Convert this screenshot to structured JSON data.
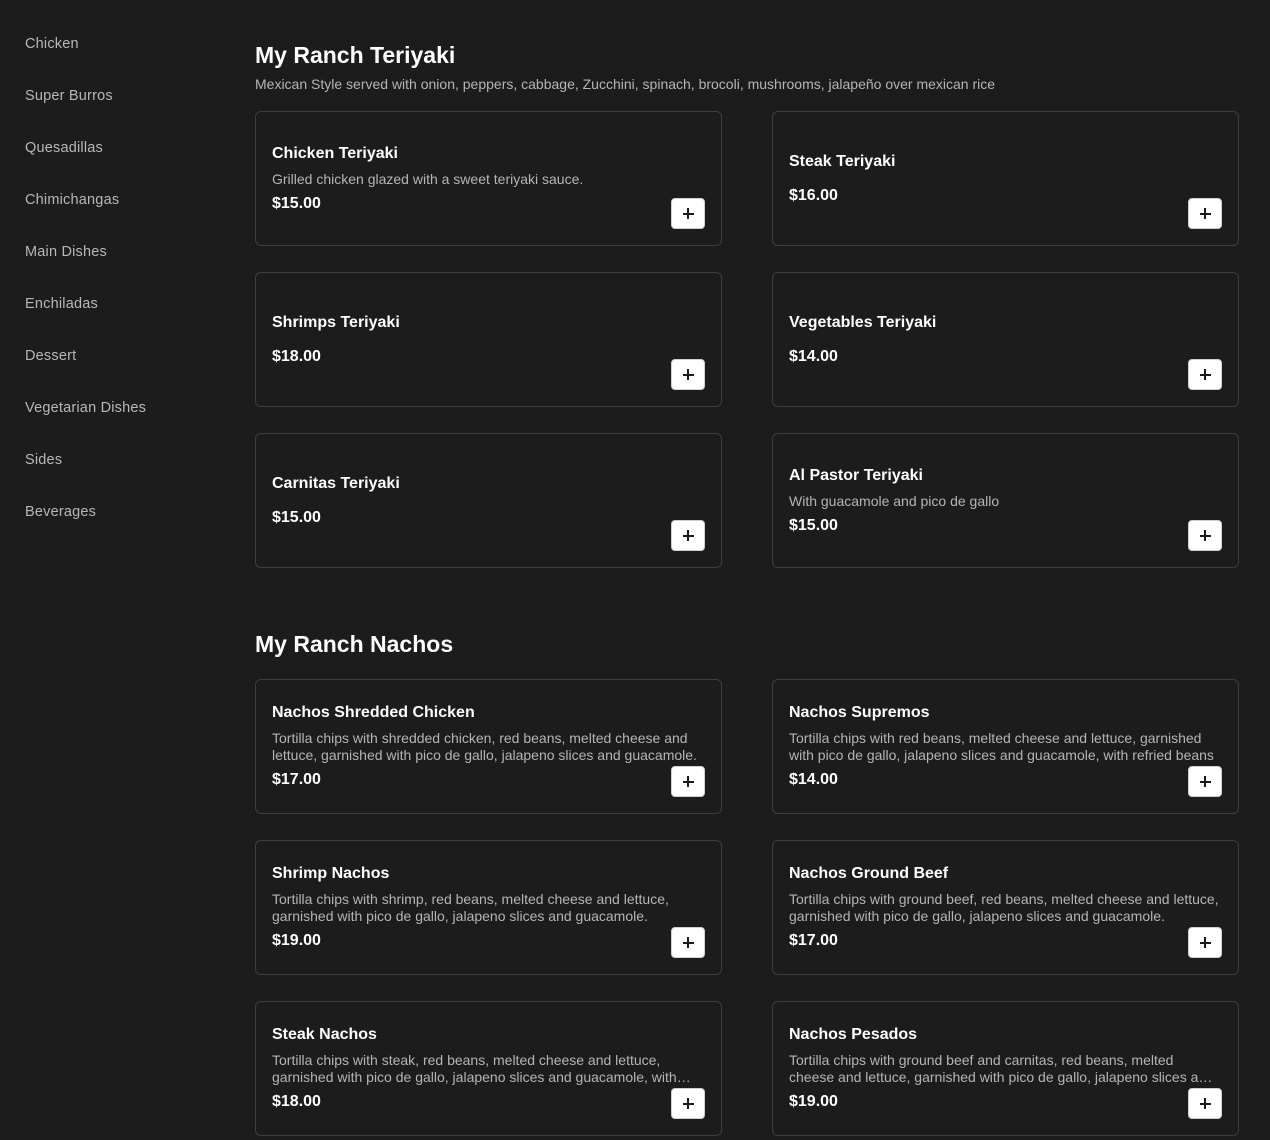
{
  "sidebar": {
    "items": [
      {
        "label": "Chicken"
      },
      {
        "label": "Super Burros"
      },
      {
        "label": "Quesadillas"
      },
      {
        "label": "Chimichangas"
      },
      {
        "label": "Main Dishes"
      },
      {
        "label": "Enchiladas"
      },
      {
        "label": "Dessert"
      },
      {
        "label": "Vegetarian Dishes"
      },
      {
        "label": "Sides"
      },
      {
        "label": "Beverages"
      }
    ]
  },
  "sections": [
    {
      "title": "My Ranch Teriyaki",
      "description": "Mexican Style served with onion, peppers, cabbage, Zucchini, spinach, brocoli, mushrooms, jalapeño over mexican rice",
      "items": [
        {
          "name": "Chicken Teriyaki",
          "description": "Grilled chicken glazed with a sweet teriyaki sauce.",
          "price": "$15.00"
        },
        {
          "name": "Steak Teriyaki",
          "description": "",
          "price": "$16.00"
        },
        {
          "name": "Shrimps Teriyaki",
          "description": "",
          "price": "$18.00"
        },
        {
          "name": "Vegetables Teriyaki",
          "description": "",
          "price": "$14.00"
        },
        {
          "name": "Carnitas Teriyaki",
          "description": "",
          "price": "$15.00"
        },
        {
          "name": "Al Pastor Teriyaki",
          "description": "With guacamole and pico de gallo",
          "price": "$15.00"
        }
      ]
    },
    {
      "title": "My Ranch Nachos",
      "description": "",
      "items": [
        {
          "name": "Nachos Shredded Chicken",
          "description": "Tortilla chips with shredded chicken, red beans, melted cheese and lettuce, garnished with pico de gallo, jalapeno slices and guacamole.",
          "price": "$17.00"
        },
        {
          "name": "Nachos Supremos",
          "description": "Tortilla chips with red beans, melted cheese and lettuce, garnished with pico de gallo, jalapeno slices and guacamole, with refried beans",
          "price": "$14.00"
        },
        {
          "name": "Shrimp Nachos",
          "description": "Tortilla chips with shrimp, red beans, melted cheese and lettuce, garnished with pico de gallo, jalapeno slices and guacamole.",
          "price": "$19.00"
        },
        {
          "name": "Nachos Ground Beef",
          "description": "Tortilla chips with ground beef, red beans, melted cheese and lettuce, garnished with pico de gallo, jalapeno slices and guacamole.",
          "price": "$17.00"
        },
        {
          "name": "Steak Nachos",
          "description": "Tortilla chips with steak, red beans, melted cheese and lettuce, garnished with pico de gallo, jalapeno slices and guacamole, with refried beans",
          "price": "$18.00"
        },
        {
          "name": "Nachos Pesados",
          "description": "Tortilla chips with ground beef and carnitas, red beans, melted cheese and lettuce, garnished with pico de gallo, jalapeno slices and guacamole.",
          "price": "$19.00"
        }
      ]
    }
  ],
  "icons": {
    "add": "plus-icon"
  },
  "colors": {
    "background": "#1c1c1c",
    "card_border": "#3e3e3e",
    "muted_text": "#b5b5b5",
    "button_bg": "#ffffff"
  }
}
